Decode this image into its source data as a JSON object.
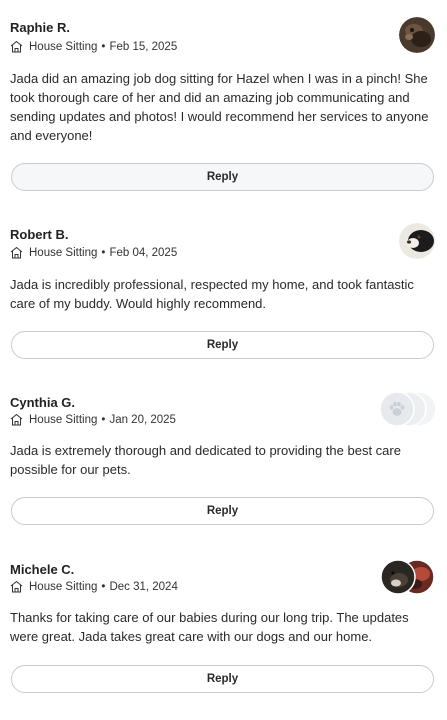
{
  "reviews": [
    {
      "name": "Raphie R.",
      "service": "House Sitting",
      "date": "Feb 15, 2025",
      "text": "Jada did an amazing job dog sitting for Hazel when I was in a pinch! She took thorough care of her and did an amazing job communicating and sending updates and photos! I would recommend her services to anyone and everyone!",
      "reply_label": "Reply"
    },
    {
      "name": "Robert B.",
      "service": "House Sitting",
      "date": "Feb 04, 2025",
      "text": "Jada is incredibly professional, respected my home, and took fantastic care of my buddy. Would highly recommend.",
      "reply_label": "Reply"
    },
    {
      "name": "Cynthia G.",
      "service": "House Sitting",
      "date": "Jan 20, 2025",
      "text": "Jada is extremely thorough and dedicated to providing the best care possible for our pets.",
      "reply_label": "Reply"
    },
    {
      "name": "Michele C.",
      "service": "House Sitting",
      "date": "Dec 31, 2024",
      "text": "Thanks for taking care of our babies during our long trip. The updates were great. Jada takes great care with our dogs and our home.",
      "reply_label": "Reply"
    }
  ],
  "icons": {
    "service": "house-sitting-icon",
    "placeholder_avatar": "paw-icon"
  },
  "colors": {
    "text": "#2a2a2a",
    "button_border": "#c8ccd0",
    "placeholder_avatar": "#e8ebee"
  }
}
